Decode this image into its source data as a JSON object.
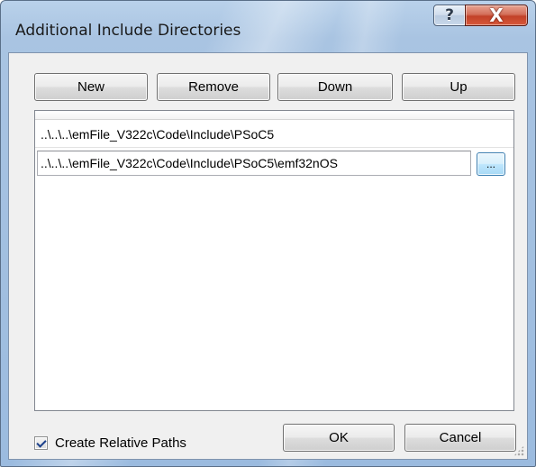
{
  "window": {
    "title": "Additional Include Directories",
    "help_glyph": "?",
    "close_glyph": "X"
  },
  "toolbar": {
    "new_label": "New",
    "remove_label": "Remove",
    "down_label": "Down",
    "up_label": "Up"
  },
  "directories": [
    {
      "path": "..\\..\\..\\emFile_V322c\\Code\\Include\\PSoC5",
      "editing": false
    },
    {
      "path": "..\\..\\..\\emFile_V322c\\Code\\Include\\PSoC5\\emf32nOS",
      "editing": true
    }
  ],
  "browse_button": {
    "label": "..."
  },
  "options": {
    "create_relative_paths_label": "Create Relative Paths",
    "create_relative_paths_checked": true
  },
  "footer": {
    "ok_label": "OK",
    "cancel_label": "Cancel"
  },
  "icons": {
    "help": "help-icon",
    "close": "close-icon",
    "checkbox": "checkmark-icon",
    "grip": "resize-grip-icon"
  },
  "colors": {
    "frame": "#a9c4e2",
    "close_button": "#c24128",
    "client_background": "#f0f0f0",
    "browse_button_accent": "#3c7fb1"
  }
}
